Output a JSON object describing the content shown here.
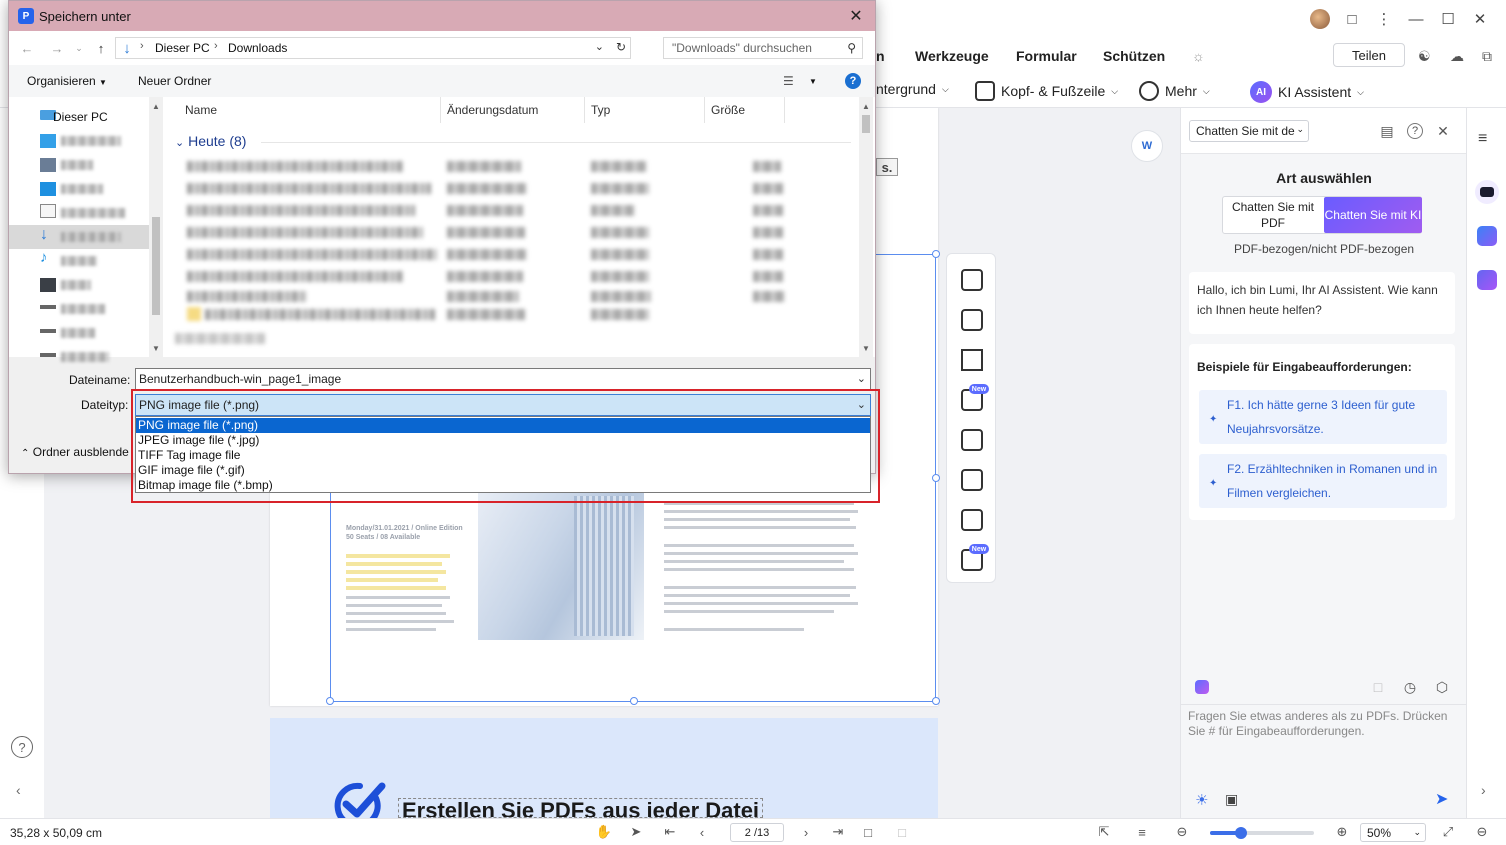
{
  "app": {
    "menu": [
      "n",
      "Werkzeuge",
      "Formular",
      "Schützen"
    ],
    "share_label": "Teilen",
    "toolbar": {
      "background_label": "ntergrund",
      "header_footer_label": "Kopf- & Fußzeile",
      "more_label": "Mehr",
      "ai_assistant_label": "KI Assistent",
      "ai_badge": "AI"
    },
    "page_tag": "s.",
    "page2_title": "Erstellen Sie PDFs aus jeder Datei",
    "doc_heading": "Monday/31.01.2021 / Online Edition\n50 Seats / 08 Available",
    "tool_badge_new": "New",
    "word_float_label": "W"
  },
  "ai_panel": {
    "chat_select": "Chatten Sie mit de",
    "art_title": "Art auswählen",
    "mode_pdf": "Chatten Sie mit PDF",
    "mode_ai": "Chatten Sie mit KI",
    "mode_sub": "PDF-bezogen/nicht PDF-bezogen",
    "greeting": "Hallo, ich bin Lumi, Ihr AI Assistent. Wie kann ich Ihnen heute helfen?",
    "examples_title": "Beispiele für Eingabeaufforderungen:",
    "examples": [
      "F1. Ich hätte gerne 3 Ideen für gute Neujahrsvorsätze.",
      "F2. Erzähltechniken in Romanen und in Filmen vergleichen."
    ],
    "input_placeholder": "Fragen Sie etwas anderes als zu PDFs. Drücken Sie # für Eingabeaufforderungen."
  },
  "statusbar": {
    "dimensions": "35,28 x 50,09 cm",
    "page_indicator": "2 /13",
    "zoom": "50%",
    "zoom_fraction": 0.3
  },
  "dialog": {
    "title": "Speichern unter",
    "breadcrumb": [
      "Dieser PC",
      "Downloads"
    ],
    "search_placeholder": "\"Downloads\" durchsuchen",
    "organize_label": "Organisieren",
    "new_folder_label": "Neuer Ordner",
    "nav_this_pc": "Dieser PC",
    "columns": [
      "Name",
      "Änderungsdatum",
      "Typ",
      "Größe"
    ],
    "group_label": "Heute (8)",
    "filename_label": "Dateiname:",
    "filename_value": "Benutzerhandbuch-win_page1_image",
    "filetype_label": "Dateityp:",
    "filetype_value": "PNG image file (*.png)",
    "filetype_options": [
      "PNG image file (*.png)",
      "JPEG image file (*.jpg)",
      "TIFF Tag image file",
      "GIF image file (*.gif)",
      "Bitmap image file (*.bmp)"
    ],
    "hide_folders_label": "Ordner ausblende"
  },
  "colors": {
    "dialog_title_bg": "#d8aab5",
    "accent_blue": "#0a66d0",
    "ai_gradient_start": "#6a5cff",
    "highlight_red": "#d8232a"
  }
}
